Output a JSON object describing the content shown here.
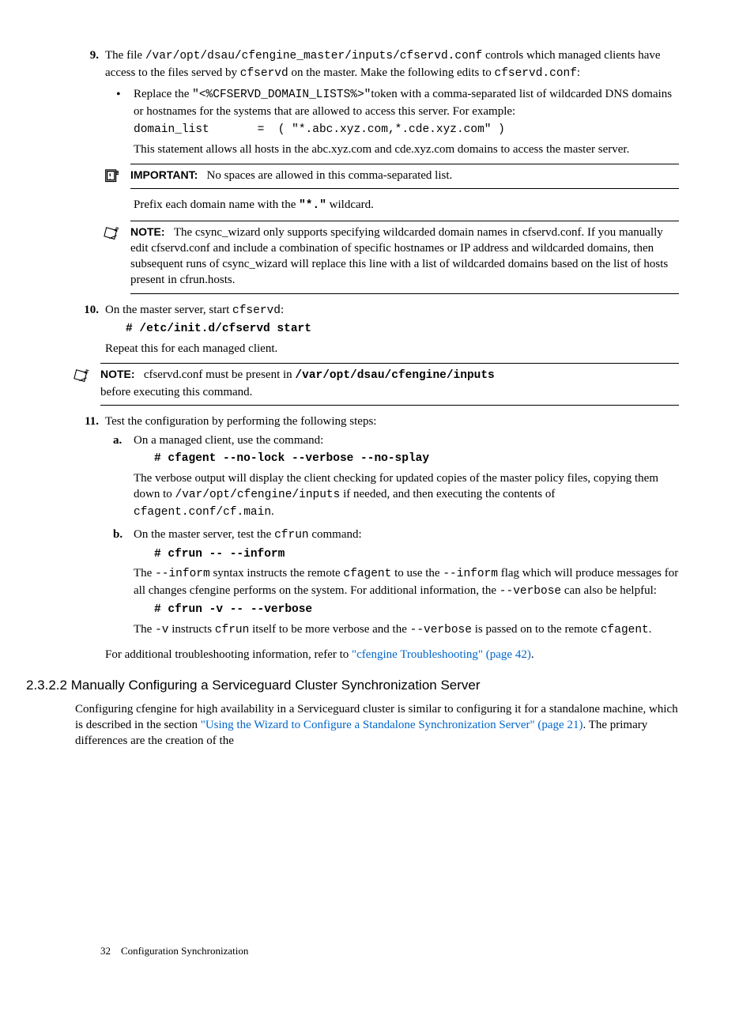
{
  "steps": {
    "s9": {
      "num": "9.",
      "p1_a": "The file ",
      "p1_code": "/var/opt/dsau/cfengine_master/inputs/cfservd.conf",
      "p1_b": " controls which managed clients have access to the files served by ",
      "p1_code2": "cfservd",
      "p1_c": " on the master. Make the following edits to ",
      "p1_code3": "cfservd.conf",
      "p1_d": ":",
      "bullet": {
        "b1_a": "Replace the ",
        "b1_code": "\"<%CFSERVD_DOMAIN_LISTS%>\"",
        "b1_b": "token with a comma-separated list of wildcarded DNS domains or hostnames for the systems that are allowed to access this server. For example:",
        "code_line": "domain_list       =  ( \"*.abc.xyz.com,*.cde.xyz.com\" )",
        "after": "This statement allows all hosts in the abc.xyz.com and cde.xyz.com domains to access the master server.",
        "important_label": "IMPORTANT:",
        "important_text": "No spaces are allowed in this comma-separated list.",
        "prefix_a": "Prefix each domain name with the ",
        "prefix_code": "\"*.\"",
        "prefix_b": " wildcard.",
        "note_label": "NOTE:",
        "note_text": "The csync_wizard only supports specifying wildcarded domain names in cfservd.conf. If you manually edit cfservd.conf and include a combination of specific hostnames or IP address and wildcarded domains, then subsequent runs of csync_wizard will replace this line with a list of wildcarded domains based on the list of hosts present in cfrun.hosts."
      }
    },
    "s10": {
      "num": "10.",
      "p1_a": "On the master server, start ",
      "p1_code": "cfservd",
      "p1_b": ":",
      "cmd": "# /etc/init.d/cfservd start",
      "p2": "Repeat this for each managed client.",
      "note_label": "NOTE:",
      "note_a": "cfservd.conf must be present in ",
      "note_code": "/var/opt/dsau/cfengine/inputs",
      "note_b": "before executing this command."
    },
    "s11": {
      "num": "11.",
      "intro": "Test the configuration by performing the following steps:",
      "a": {
        "letter": "a.",
        "p1": "On a managed client, use the command:",
        "cmd": "# cfagent --no-lock --verbose --no-splay",
        "p2_a": "The verbose output will display the client checking for updated copies of the master policy files, copying them down to ",
        "p2_code1": "/var/opt/cfengine/inputs",
        "p2_b": " if needed, and then executing the contents of ",
        "p2_code2": "cfagent.conf/cf.main",
        "p2_c": "."
      },
      "b": {
        "letter": "b.",
        "p1_a": "On the master server, test the ",
        "p1_code": "cfrun",
        "p1_b": " command:",
        "cmd1": "# cfrun -- --inform",
        "p2_a": "The ",
        "p2_code1": "--inform",
        "p2_b": " syntax instructs the remote ",
        "p2_code2": "cfagent",
        "p2_c": " to use the ",
        "p2_code3": "--inform",
        "p2_d": " flag which will produce messages for all changes cfengine performs on the system. For additional information, the ",
        "p2_code4": "--verbose",
        "p2_e": " can also be helpful:",
        "cmd2": "# cfrun -v -- --verbose",
        "p3_a": "The ",
        "p3_code1": "-v",
        "p3_b": " instructs ",
        "p3_code2": "cfrun",
        "p3_c": " itself to be more verbose and the ",
        "p3_code3": "--verbose",
        "p3_d": " is passed on to the remote ",
        "p3_code4": "cfagent",
        "p3_e": "."
      },
      "closing_a": "For additional troubleshooting information, refer to ",
      "closing_link": "\"cfengine Troubleshooting\" (page 42)",
      "closing_b": "."
    }
  },
  "section": {
    "title": "2.3.2.2 Manually Configuring a Serviceguard Cluster Synchronization Server",
    "p_a": "Configuring cfengine for high availability in a Serviceguard cluster is similar to configuring it for a standalone machine, which is described in the section ",
    "p_link": "\"Using the Wizard to Configure a Standalone Synchronization Server\" (page 21)",
    "p_b": ". The primary differences are the creation of the"
  },
  "footer": {
    "page": "32",
    "title": "Configuration Synchronization"
  }
}
